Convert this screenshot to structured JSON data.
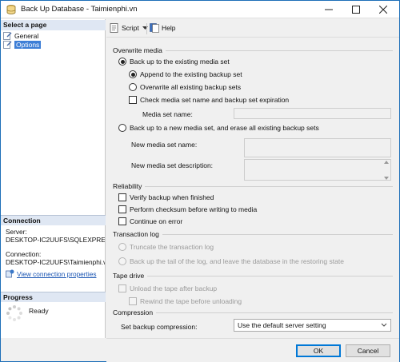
{
  "window": {
    "title": "Back Up Database - Taimienphi.vn"
  },
  "left": {
    "select_page_header": "Select a page",
    "pages": [
      {
        "label": "General"
      },
      {
        "label": "Options"
      }
    ],
    "connection_header": "Connection",
    "server_label": "Server:",
    "server_value": "DESKTOP-IC2UUFS\\SQLEXPRE",
    "connection_label": "Connection:",
    "connection_value": "DESKTOP-IC2UUFS\\Taimienphi.v",
    "view_connection": "View connection properties",
    "progress_header": "Progress",
    "progress_status": "Ready"
  },
  "toolbar": {
    "script": "Script",
    "help": "Help"
  },
  "overwrite": {
    "header": "Overwrite media",
    "existing_set": "Back up to the existing media set",
    "append": "Append to the existing backup set",
    "overwrite_all": "Overwrite all existing backup sets",
    "check_name": "Check media set name and backup set expiration",
    "media_set_name": "Media set name:",
    "new_set": "Back up to a new media set, and erase all existing backup sets",
    "new_name": "New media set name:",
    "new_desc": "New media set description:"
  },
  "reliability": {
    "header": "Reliability",
    "verify": "Verify backup when finished",
    "checksum": "Perform checksum before writing to media",
    "continue": "Continue on error"
  },
  "txlog": {
    "header": "Transaction log",
    "truncate": "Truncate the transaction log",
    "tail": "Back up the tail of the log, and leave the database in the restoring state"
  },
  "tape": {
    "header": "Tape drive",
    "unload": "Unload the tape after backup",
    "rewind": "Rewind the tape before unloading"
  },
  "compression": {
    "header": "Compression",
    "label": "Set backup compression:",
    "value": "Use the default server setting"
  },
  "buttons": {
    "ok": "OK",
    "cancel": "Cancel"
  },
  "colors": {
    "accent": "#0078d7",
    "selected": "#3d7ed6",
    "section_bg": "#dfe7f3",
    "link": "#1a55b3"
  }
}
